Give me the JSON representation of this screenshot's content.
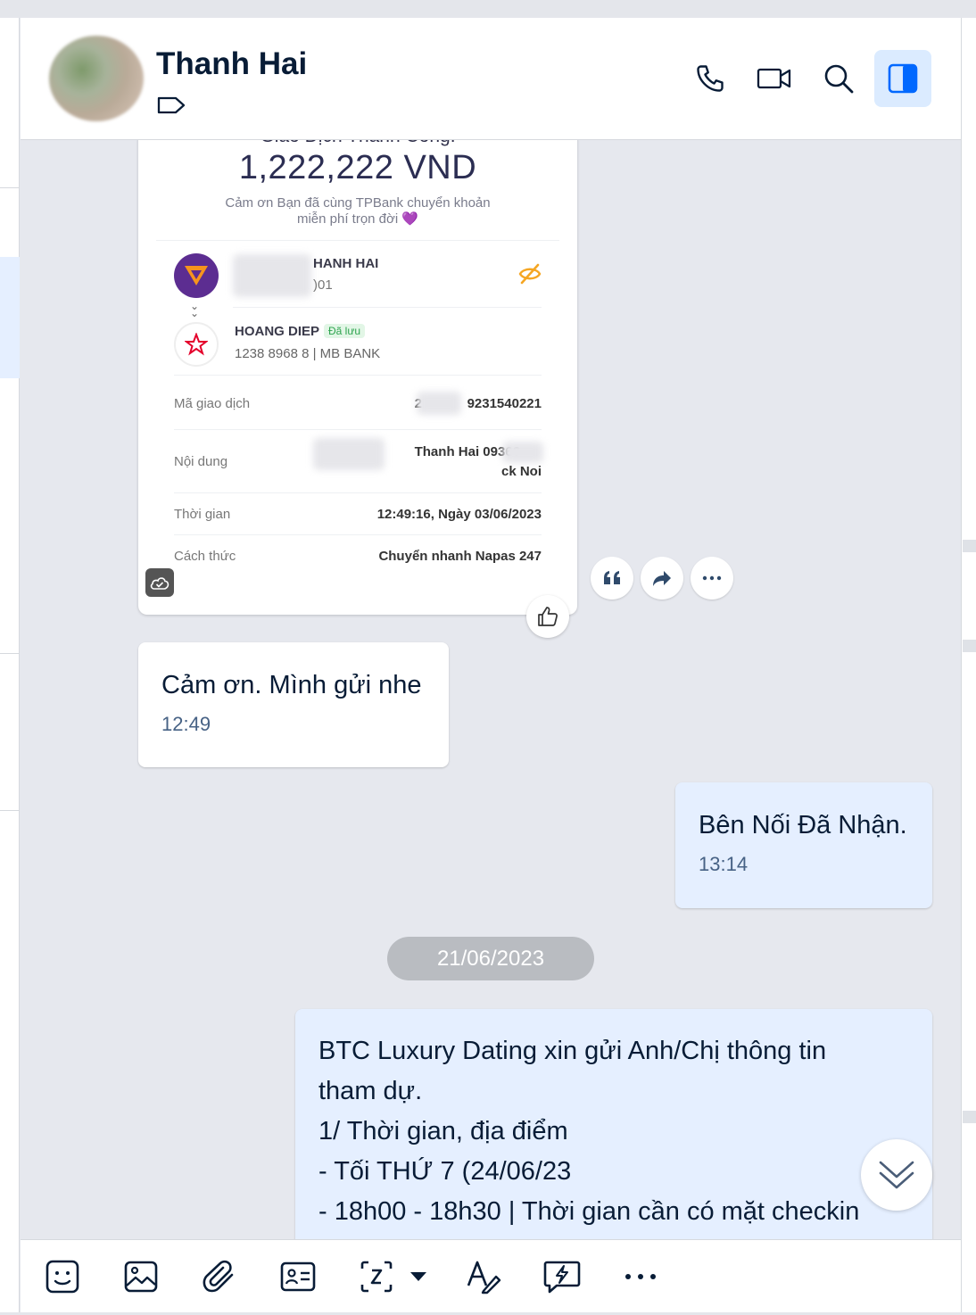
{
  "header": {
    "contact_name": "Thanh Hai",
    "icons": [
      "tag-icon",
      "phone-icon",
      "video-call-icon",
      "search-icon",
      "sidebar-toggle-icon"
    ]
  },
  "receipt": {
    "title_cut": "Giao Dịch Thành Công!",
    "amount": "1,222,222 VND",
    "thanks_line1": "Cảm ơn Bạn đã cùng TPBank chuyển khoản",
    "thanks_line2": "miễn phí trọn đời 💜",
    "sender_name": "HANH HAI",
    "sender_account": ")01",
    "receiver_name": "HOANG DIEP",
    "receiver_saved_badge": "Đã lưu",
    "receiver_account": "1238 8968 8 | MB BANK",
    "rows": [
      {
        "label": "Mã giao dịch",
        "value": "2",
        "value2": "9231540221"
      },
      {
        "label": "Nội dung",
        "value": "Thanh Hai 09366",
        "value2": "ck Noi"
      },
      {
        "label": "Thời gian",
        "value": "12:49:16, Ngày 03/06/2023"
      },
      {
        "label": "Cách thức",
        "value": "Chuyển nhanh Napas 247"
      }
    ]
  },
  "message_actions": [
    "quote-icon",
    "forward-icon",
    "more-icon"
  ],
  "messages": [
    {
      "direction": "in",
      "text": "Cảm ơn. Mình gửi nhe",
      "time": "12:49"
    },
    {
      "direction": "out",
      "text": "Bên Nối Đã Nhận.",
      "time": "13:14"
    }
  ],
  "date_separator": "21/06/2023",
  "long_message": {
    "lines": [
      "BTC Luxury Dating xin gửi Anh/Chị thông tin",
      "tham dự.",
      "1/ Thời gian, địa điểm",
      "- Tối THỨ 7 (24/06/23",
      "- 18h00 - 18h30 | Thời gian cần có mặt checkin"
    ]
  },
  "toolbar": {
    "icons": [
      "sticker-icon",
      "image-icon",
      "attachment-icon",
      "contact-card-icon",
      "screenshot-icon",
      "dropdown-caret-icon",
      "text-format-icon",
      "quick-message-icon",
      "more-options-icon"
    ]
  }
}
